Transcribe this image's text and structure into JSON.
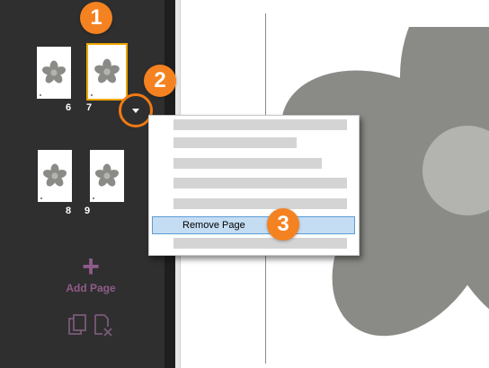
{
  "sidebar": {
    "pages": [
      {
        "number": "6",
        "selected": false
      },
      {
        "number": "7",
        "selected": true
      },
      {
        "number": "8",
        "selected": false
      },
      {
        "number": "9",
        "selected": false
      }
    ],
    "add_page_label": "Add Page"
  },
  "context_menu": {
    "highlighted_item": "Remove Page"
  },
  "callouts": [
    "1",
    "2",
    "3"
  ],
  "colors": {
    "sidebar_bg": "#2f2f2f",
    "accent_orange": "#f58220",
    "selection_border": "#f0a500",
    "add_page_purple": "#8f5c8a",
    "menu_highlight": "#c5ddf3",
    "flower_gray": "#8a8b87",
    "flower_center": "#b3b4b0"
  },
  "icons": [
    "flower-icon",
    "plus-icon",
    "copy-page-icon",
    "delete-page-icon",
    "dropdown-caret-icon"
  ]
}
